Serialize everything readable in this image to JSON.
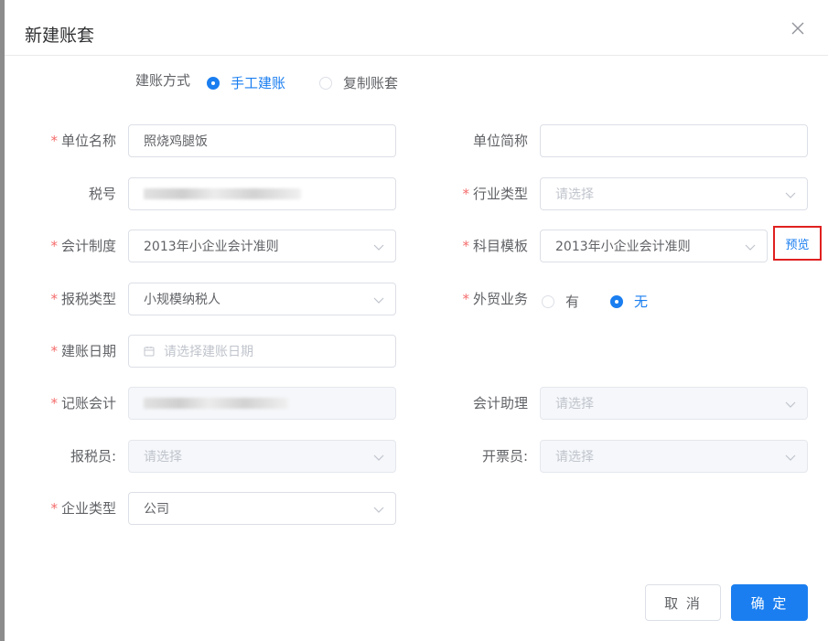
{
  "dialog": {
    "title": "新建账套",
    "close_icon": "close-icon"
  },
  "setup_method": {
    "label": "建账方式",
    "options": [
      {
        "label": "手工建账",
        "checked": true
      },
      {
        "label": "复制账套",
        "checked": false
      }
    ]
  },
  "form": {
    "unit_name": {
      "label": "单位名称",
      "required": "*",
      "value": "照烧鸡腿饭"
    },
    "unit_abbr": {
      "label": "单位简称",
      "value": ""
    },
    "tax_no": {
      "label": "税号",
      "value_redacted": true
    },
    "industry": {
      "label": "行业类型",
      "required": "*",
      "placeholder": "请选择"
    },
    "accounting_system": {
      "label": "会计制度",
      "required": "*",
      "value": "2013年小企业会计准则"
    },
    "subject_template": {
      "label": "科目模板",
      "required": "*",
      "value": "2013年小企业会计准则",
      "preview": "预览"
    },
    "tax_type": {
      "label": "报税类型",
      "required": "*",
      "value": "小规模纳税人"
    },
    "foreign_trade": {
      "label": "外贸业务",
      "required": "*",
      "options": [
        {
          "label": "有",
          "checked": false
        },
        {
          "label": "无",
          "checked": true
        }
      ]
    },
    "setup_date": {
      "label": "建账日期",
      "required": "*",
      "placeholder": "请选择建账日期"
    },
    "bookkeeper": {
      "label": "记账会计",
      "required": "*",
      "value_redacted": true
    },
    "assistant": {
      "label": "会计助理",
      "placeholder": "请选择"
    },
    "tax_filer": {
      "label": "报税员:",
      "placeholder": "请选择"
    },
    "invoicer": {
      "label": "开票员:",
      "placeholder": "请选择"
    },
    "company_type": {
      "label": "企业类型",
      "required": "*",
      "value": "公司"
    }
  },
  "footer": {
    "cancel": "取 消",
    "confirm": "确 定"
  },
  "colors": {
    "primary": "#1a7ef0",
    "required": "#f56c6c",
    "highlight_border": "#e02020"
  }
}
